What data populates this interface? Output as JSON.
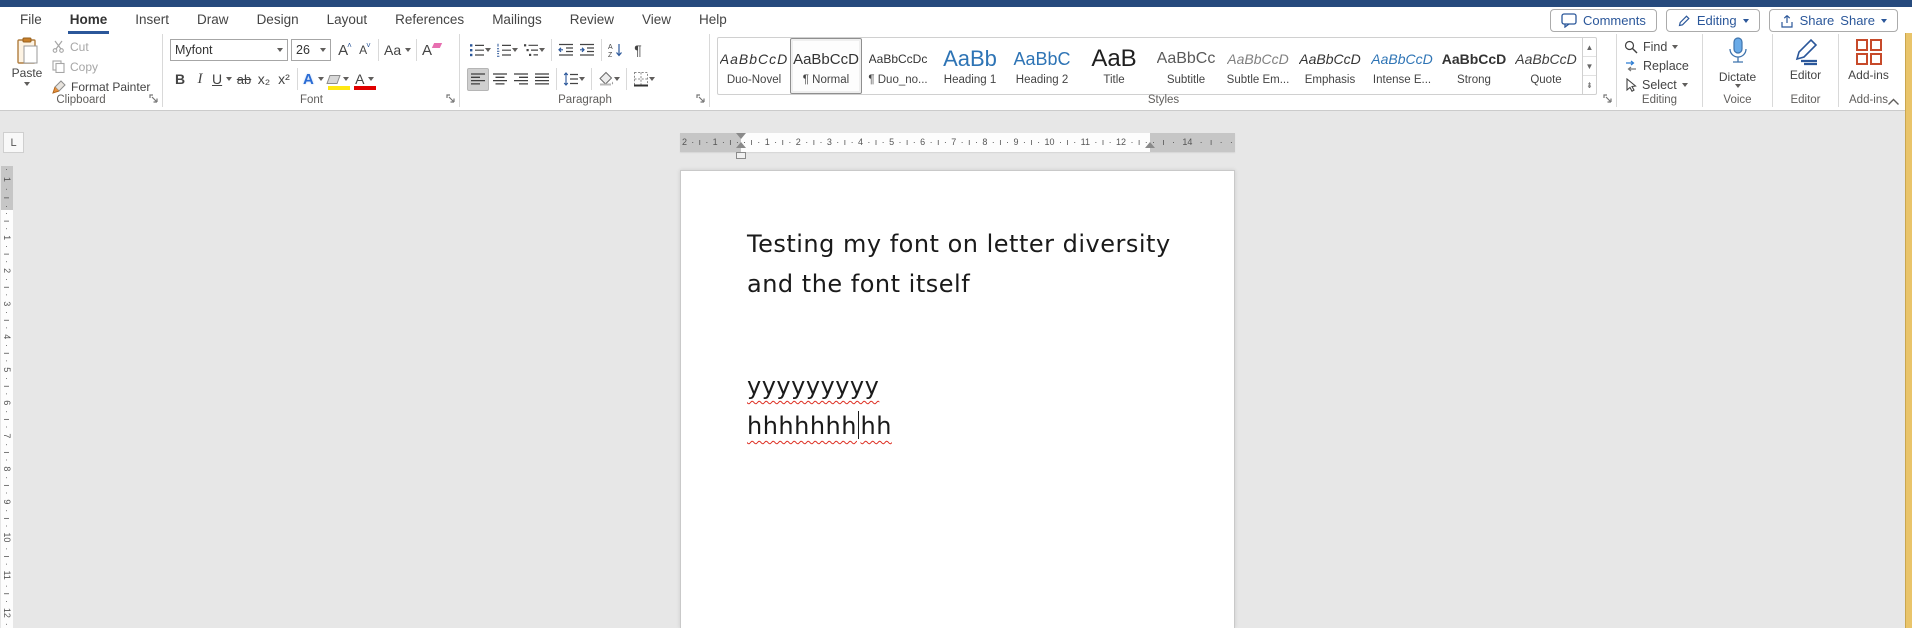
{
  "menu": {
    "tabs": [
      {
        "label": "File"
      },
      {
        "label": "Home"
      },
      {
        "label": "Insert"
      },
      {
        "label": "Draw"
      },
      {
        "label": "Design"
      },
      {
        "label": "Layout"
      },
      {
        "label": "References"
      },
      {
        "label": "Mailings"
      },
      {
        "label": "Review"
      },
      {
        "label": "View"
      },
      {
        "label": "Help"
      }
    ],
    "comments": "Comments",
    "editing": "Editing",
    "share": "Share"
  },
  "ribbon": {
    "clipboard": {
      "group_label": "Clipboard",
      "paste": "Paste",
      "cut": "Cut",
      "copy": "Copy",
      "format_painter": "Format Painter"
    },
    "font": {
      "group_label": "Font",
      "name_value": "Myfont",
      "size_value": "26",
      "grow_label": "A",
      "shrink_label": "A",
      "case_label": "Aa",
      "clear_label": "A",
      "bold": "B",
      "italic": "I",
      "underline": "U",
      "strike": "ab",
      "subscript": "x₂",
      "superscript": "x²",
      "effects_label": "A",
      "color_label": "A"
    },
    "paragraph": {
      "group_label": "Paragraph",
      "pilcrow": "¶",
      "sort_a": "A",
      "sort_z": "Z"
    },
    "styles": {
      "group_label": "Styles",
      "items": [
        {
          "preview": "AaBbCcD",
          "name": "Duo-Novel"
        },
        {
          "preview": "AaBbCcD",
          "name": "¶ Normal",
          "selected": true
        },
        {
          "preview": "AaBbCcDc",
          "name": "¶ Duo_no..."
        },
        {
          "preview": "AaBb",
          "name": "Heading 1"
        },
        {
          "preview": "AaBbC",
          "name": "Heading 2"
        },
        {
          "preview": "AaB",
          "name": "Title"
        },
        {
          "preview": "AaBbCc",
          "name": "Subtitle"
        },
        {
          "preview": "AaBbCcD",
          "name": "Subtle Em..."
        },
        {
          "preview": "AaBbCcD",
          "name": "Emphasis"
        },
        {
          "preview": "AaBbCcD",
          "name": "Intense E..."
        },
        {
          "preview": "AaBbCcD",
          "name": "Strong"
        },
        {
          "preview": "AaBbCcD",
          "name": "Quote"
        }
      ]
    },
    "editing": {
      "group_label": "Editing",
      "find": "Find",
      "replace": "Replace",
      "select": "Select"
    },
    "voice": {
      "group_label": "Voice",
      "dictate": "Dictate"
    },
    "editor_group": {
      "group_label": "Editor",
      "button": "Editor"
    },
    "addins": {
      "group_label": "Add-ins",
      "button": "Add-ins"
    }
  },
  "ruler": {
    "tab_selector": "L",
    "h_left": "2 · ı · 1 · ı ·",
    "h_main": "· ı · 1 · ı · 2 · ı · 3 · ı · 4 · ı · 5 · ı · 6 · ı · 7 · ı · 8 · ı · 9 · ı · 10 · ı · 11 · ı · 12 · ı ·",
    "h_right": "· ı · 14 · ı · ·",
    "v_top": "· 1 · ı ·",
    "v_main": "· ı · 1 · ı · 2 · ı · 3 · ı · 4 · ı · 5 · ı · 6 · ı · 7 · ı · 8 · ı · 9 · ı · 10 · ı · 11 · ı · 12 ·"
  },
  "document": {
    "line1": "Testing my font on letter diversity",
    "line2": "and the font itself",
    "line3": "yyyyyyyyy",
    "line4_before_caret": "hhhhhhh",
    "line4_after_caret": "hh"
  },
  "colors": {
    "accent_blue": "#2b579a",
    "heading_blue": "#2e74b5",
    "addins_orange": "#c74a2a",
    "dictate_blue": "#6aabe8",
    "squiggle_red": "#dd2c20",
    "highlight_yellow": "#ffe812",
    "font_color_red": "#e00000",
    "titlebar_blue": "#264a7d",
    "side_strip_gold": "#e9c46a"
  }
}
